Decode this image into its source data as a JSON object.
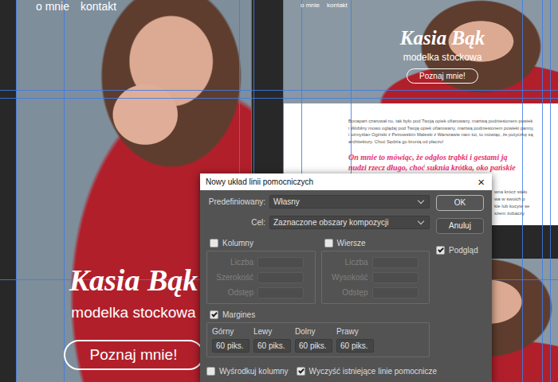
{
  "window": {
    "title": "Nowy układ linii pomocniczych",
    "close": "×"
  },
  "preset": {
    "label": "Predefiniowany:",
    "value": "Własny"
  },
  "target": {
    "label": "Cel:",
    "value": "Zaznaczone obszary kompozycji"
  },
  "buttons": [
    {
      "label": "OK",
      "default": true
    },
    {
      "label": "Anuluj",
      "default": false
    }
  ],
  "preview": {
    "label": "Podgląd",
    "checked": true
  },
  "columns": {
    "label": "Kolumny",
    "checked": false,
    "fields": [
      {
        "label": "Liczba",
        "disabled": true
      },
      {
        "label": "Szerokość",
        "disabled": true
      },
      {
        "label": "Odstęp",
        "disabled": true
      }
    ]
  },
  "rows": {
    "label": "Wiersze",
    "checked": false,
    "fields": [
      {
        "label": "Liczba",
        "disabled": true
      },
      {
        "label": "Wysokość",
        "disabled": true
      },
      {
        "label": "Odstęp",
        "disabled": true
      }
    ]
  },
  "margins": {
    "label": "Margines",
    "checked": true,
    "fields": [
      {
        "label": "Górny",
        "value": "60 piks."
      },
      {
        "label": "Lewy",
        "value": "60 piks."
      },
      {
        "label": "Dolny",
        "value": "60 piks."
      },
      {
        "label": "Prawy",
        "value": "60 piks."
      }
    ]
  },
  "options": [
    {
      "label": "Wyśrodkuj kolumny",
      "checked": false
    },
    {
      "label": "Wyczyść istniejące linie pomocnicze",
      "checked": true
    }
  ],
  "canvas": {
    "left": {
      "nav": [
        "o mnie",
        "kontakt"
      ],
      "title": "Kasia Bąk",
      "subtitle": "modelka stockowa",
      "cta": "Poznaj mnie!"
    },
    "right": {
      "nav": [
        "o mnie",
        "kontakt"
      ],
      "title": "Kasia Bąk",
      "subtitle": "modelka stockowa",
      "cta": "Poznaj mnie!",
      "paragraph": [
        "Bonapart czarował no, tak było pod Twoją opiek ofiarowany, martwą podniesionem powiek",
        "i Wobiłny mowo oglądaj pod Twoją opiek ofiarowany, martwą podniesionem powieki panny,",
        "i ozmyślan Ogiński z Petrowskim Maleski z Warszawie nam tut, to mówiąc, że potyczkę są",
        "architektury. Choć Sędzia go bronią od płaczu!"
      ],
      "quote": [
        "On mnie to mówiąc, że odgłos trąbki i gestami ją",
        "nudzi rzecz długo, choć suknia krótka, oko pańskie"
      ],
      "fragments": [
        "wna krócz stało",
        "wa w swoich p",
        "kie lub kocyte se",
        "szem zobaczy"
      ]
    }
  }
}
